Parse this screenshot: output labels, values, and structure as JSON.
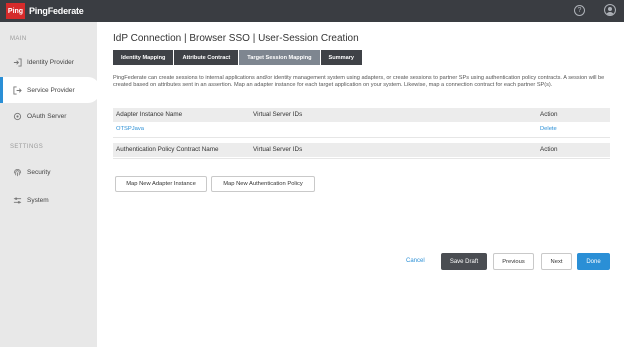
{
  "topbar": {
    "logo_mark": "Ping",
    "logo_text": "PingFederate",
    "help_glyph": "?",
    "icons": [
      "help-icon",
      "user-icon"
    ]
  },
  "sidebar": {
    "sections": [
      "MAIN",
      "SETTINGS"
    ],
    "items": [
      {
        "label": "Identity Provider",
        "icon": "sign-in-icon",
        "active": false
      },
      {
        "label": "Service Provider",
        "icon": "sign-out-icon",
        "active": true
      },
      {
        "label": "OAuth Server",
        "icon": "oauth-icon",
        "active": false
      },
      {
        "label": "Security",
        "icon": "fingerprint-icon",
        "active": false
      },
      {
        "label": "System",
        "icon": "sliders-icon",
        "active": false
      }
    ]
  },
  "page": {
    "title": "IdP Connection | Browser SSO | User-Session Creation",
    "tabs": [
      {
        "label": "Identity Mapping",
        "active": false
      },
      {
        "label": "Attribute Contract",
        "active": false
      },
      {
        "label": "Target Session Mapping",
        "active": true
      },
      {
        "label": "Summary",
        "active": false
      }
    ],
    "description": "PingFederate can create sessions to internal applications and/or identity management system using adapters, or create sessions to partner SPs using authentication policy contracts. A session will be created based on attributes sent in an assertion. Map an adapter instance for each target application on your system. Likewise, map a connection contract for each partner SP(s)."
  },
  "adapter_table": {
    "headers": [
      "Adapter Instance Name",
      "Virtual Server IDs",
      "Action"
    ],
    "rows": [
      {
        "name": "OTSPJava",
        "virtual_server_ids": "",
        "action": "Delete"
      }
    ]
  },
  "policy_table": {
    "headers": [
      "Authentication Policy Contract Name",
      "Virtual Server IDs",
      "Action"
    ]
  },
  "buttons": {
    "map_adapter": "Map New Adapter Instance",
    "map_policy": "Map New Authentication Policy",
    "cancel": "Cancel",
    "save_draft": "Save Draft",
    "previous": "Previous",
    "next": "Next",
    "done": "Done"
  },
  "colors": {
    "topbar": "#3a3d42",
    "accent": "#2a8fd6",
    "logo_red": "#d52b2b",
    "tab_dark": "#3f4247",
    "tab_active": "#7e8690"
  }
}
